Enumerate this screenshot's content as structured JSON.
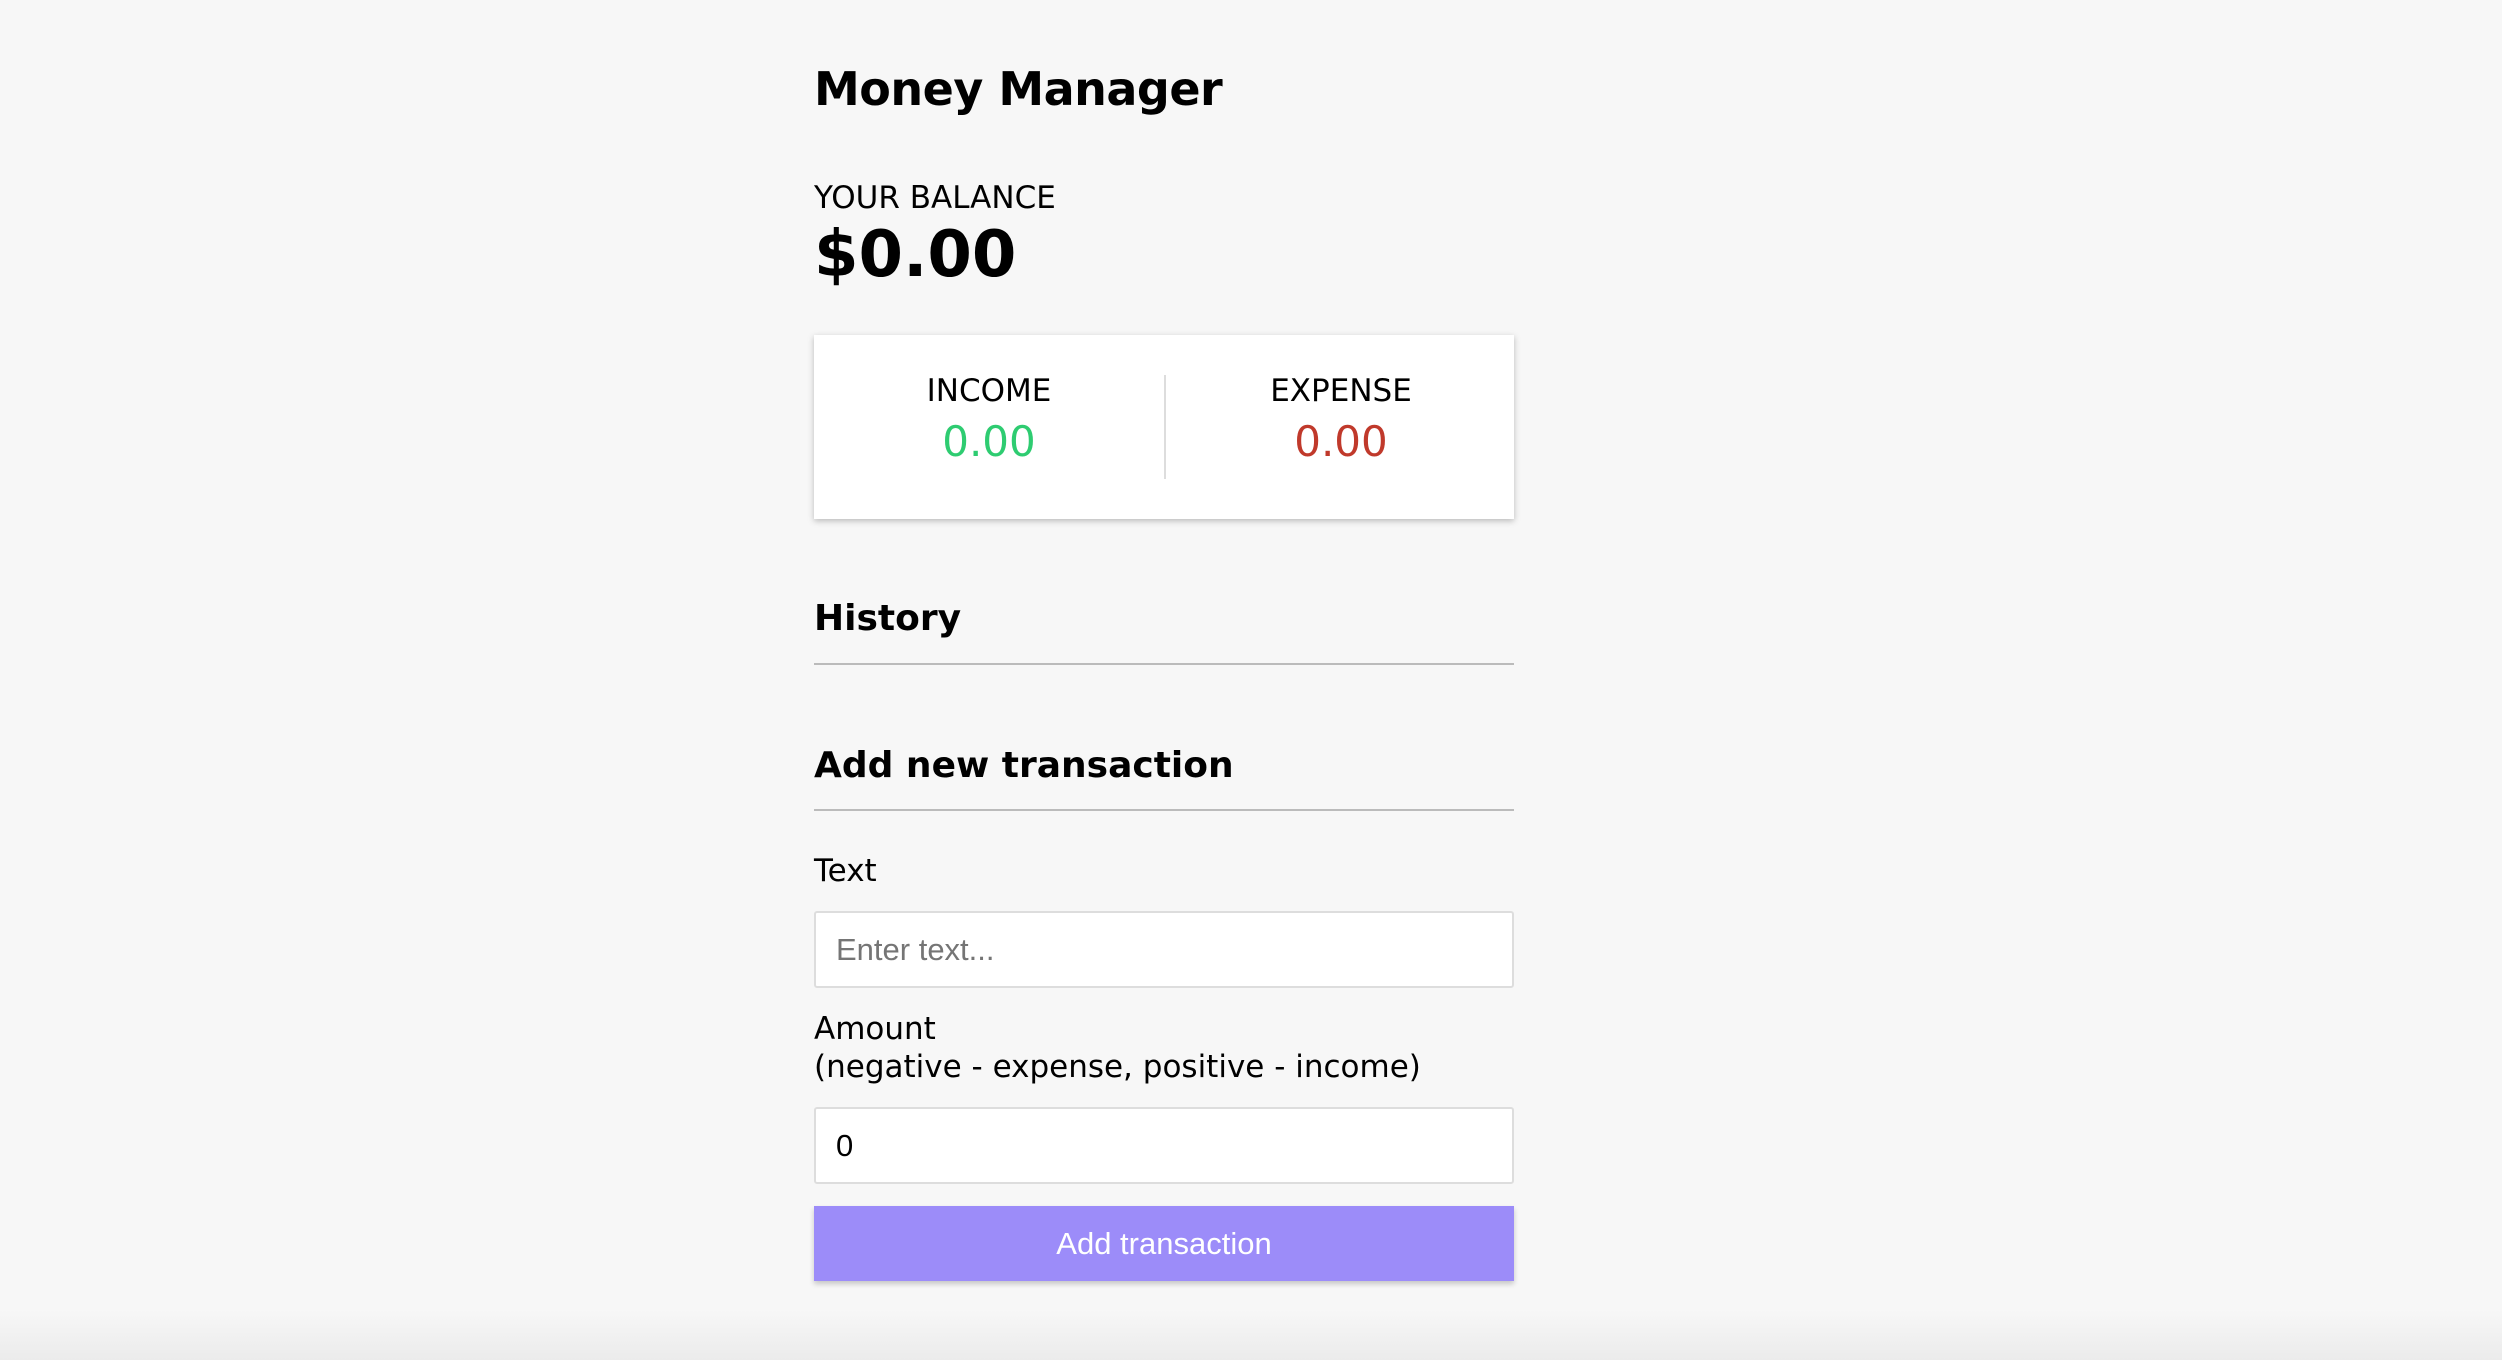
{
  "app": {
    "title": "Money Manager"
  },
  "balance": {
    "label": "YOUR BALANCE",
    "value": "$0.00"
  },
  "summary": {
    "income_label": "INCOME",
    "income_value": "0.00",
    "expense_label": "EXPENSE",
    "expense_value": "0.00",
    "income_color": "#2ecc71",
    "expense_color": "#c0392b"
  },
  "history": {
    "title": "History"
  },
  "form": {
    "title": "Add new transaction",
    "text_label": "Text",
    "text_placeholder": "Enter text...",
    "text_value": "",
    "amount_label": "Amount",
    "amount_hint": "(negative - expense, positive - income)",
    "amount_value": "0",
    "submit_label": "Add transaction",
    "accent_color": "#9c8cf9"
  }
}
